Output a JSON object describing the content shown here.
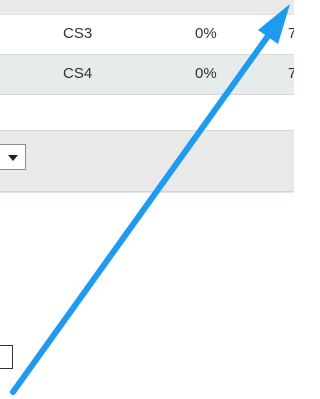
{
  "table": {
    "rows": [
      {
        "name": "CS3",
        "percent": "0%",
        "cut_off": "7"
      },
      {
        "name": "CS4",
        "percent": "0%",
        "cut_off": "7"
      }
    ]
  },
  "toolbar": {
    "dropdown_icon": "chevron-down-icon"
  },
  "annotation": {
    "arrow_color": "#1e9bf0",
    "arrow_icon": "arrow-up-right-icon"
  }
}
